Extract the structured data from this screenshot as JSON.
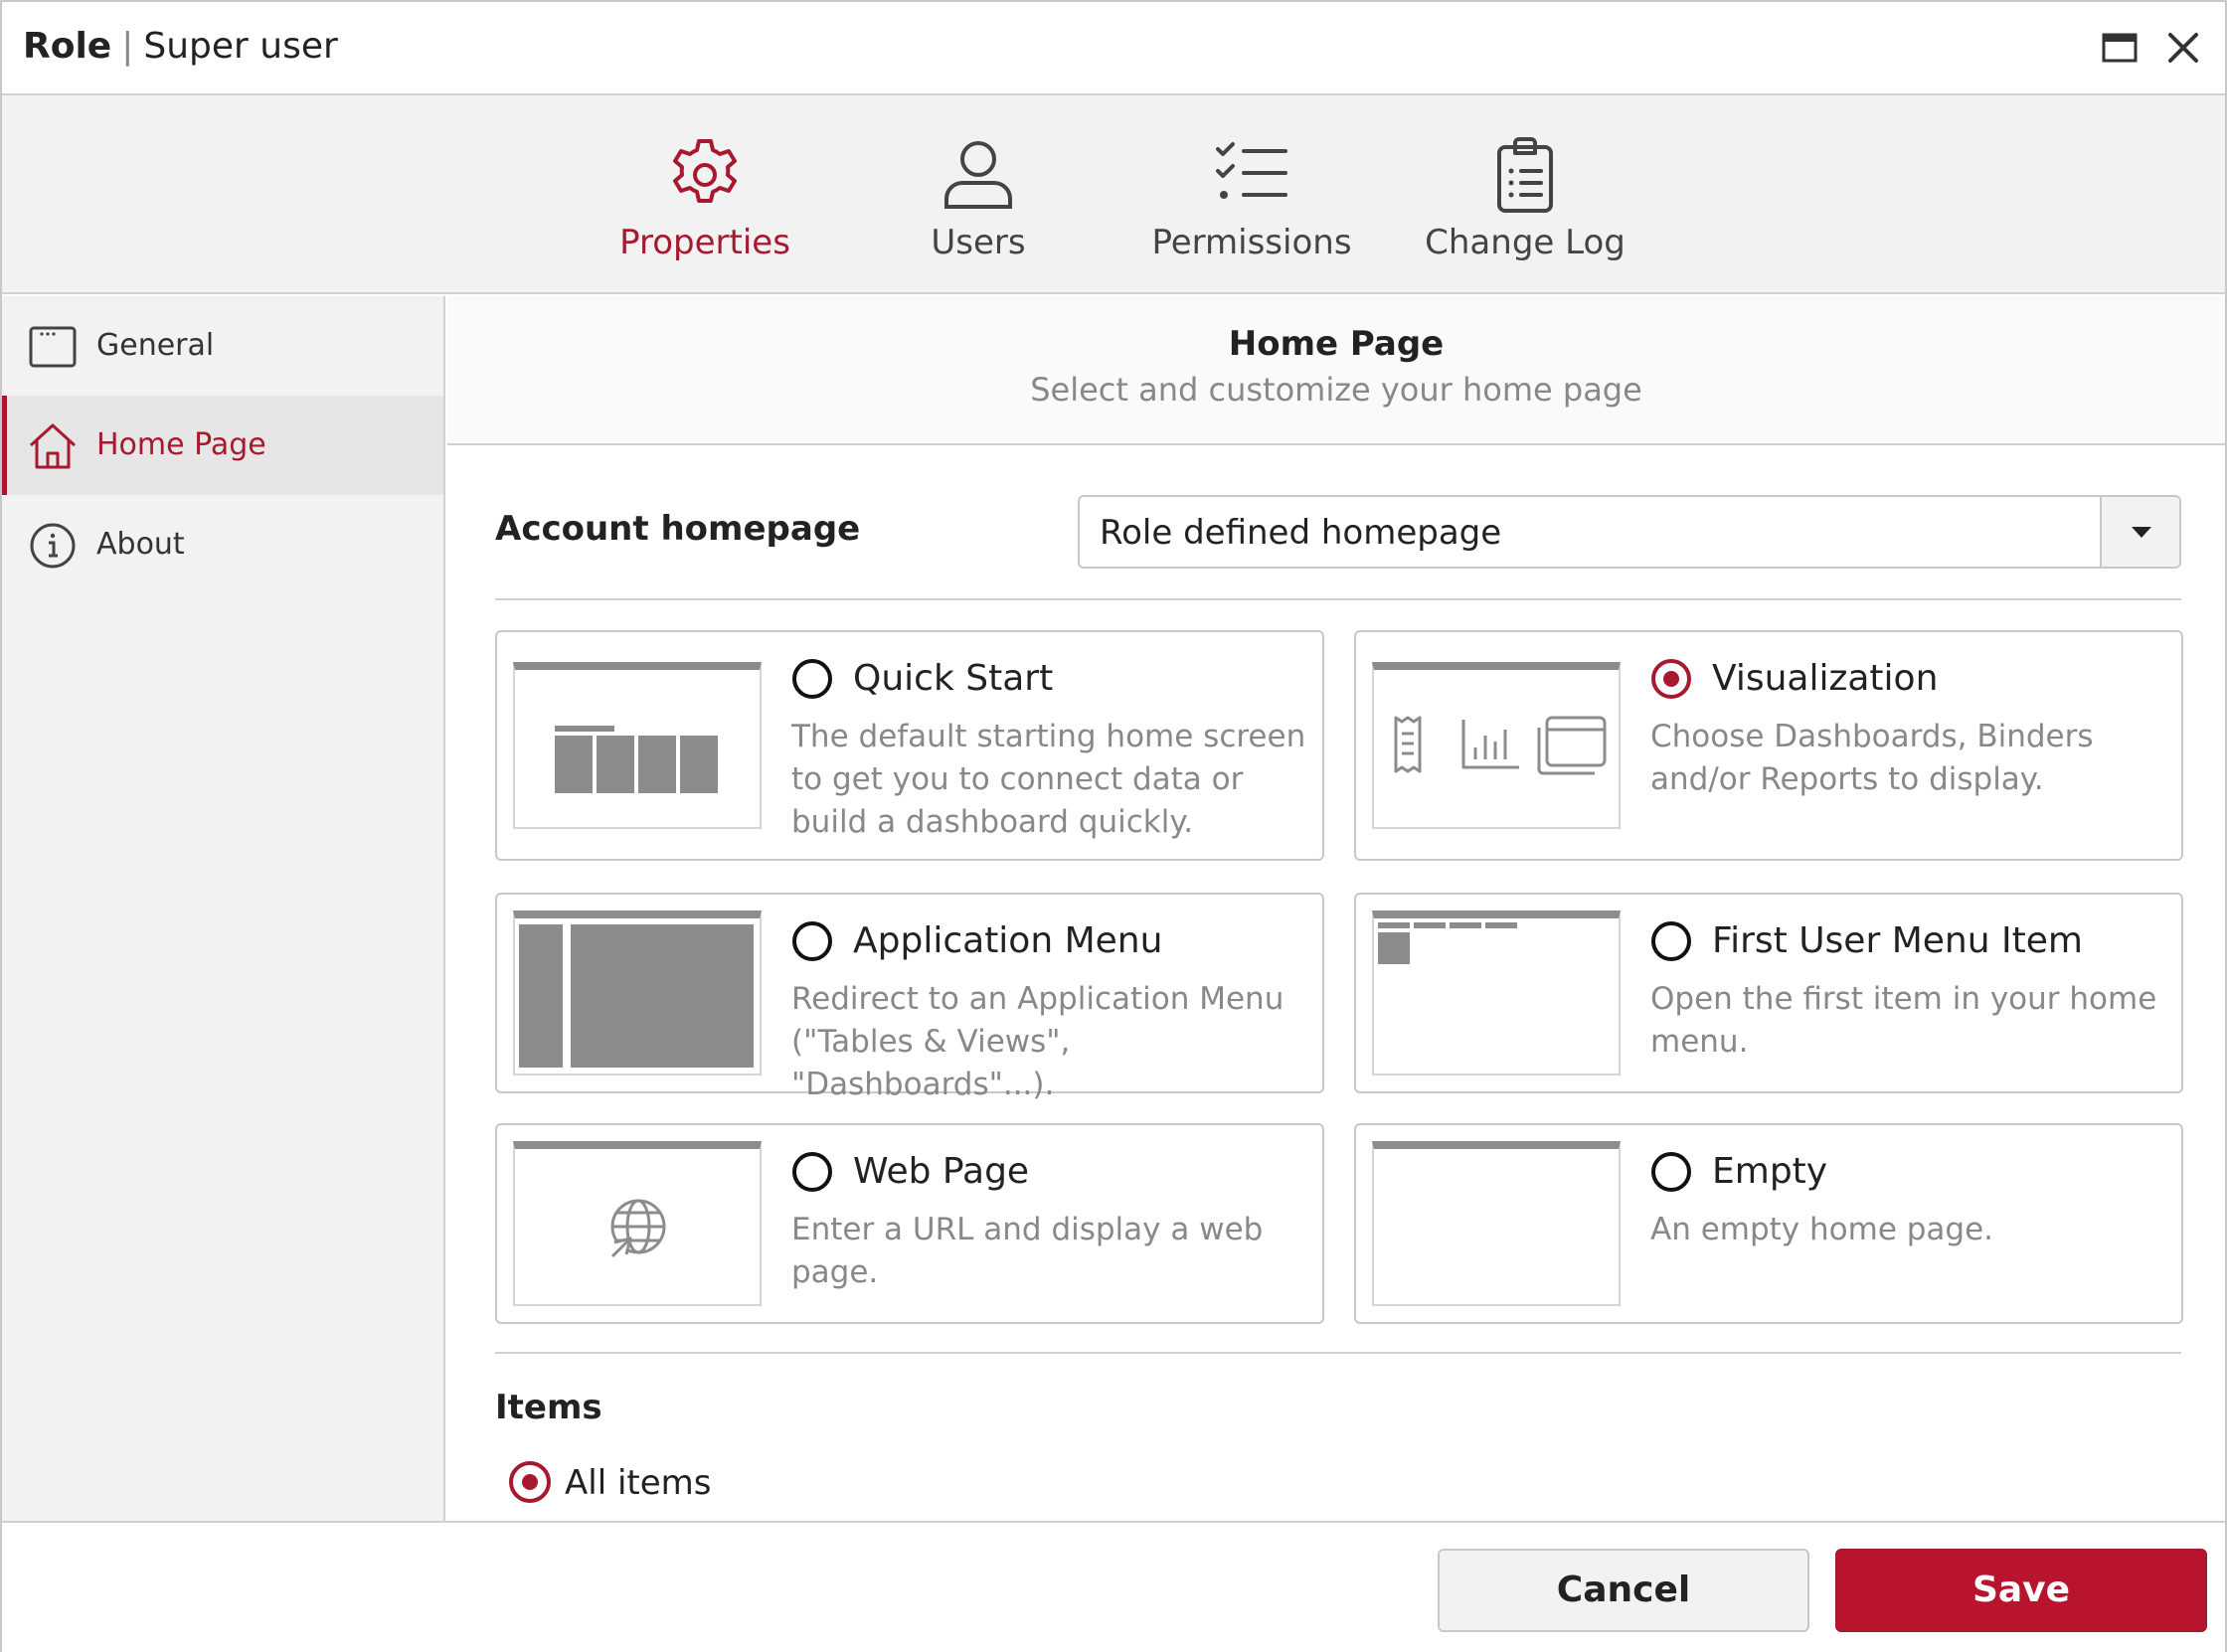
{
  "window": {
    "title_role": "Role",
    "title_separator": "|",
    "title_name": "Super user"
  },
  "tabs": [
    {
      "label": "Properties",
      "icon": "gear-icon",
      "active": true
    },
    {
      "label": "Users",
      "icon": "user-icon",
      "active": false
    },
    {
      "label": "Permissions",
      "icon": "checklist-icon",
      "active": false
    },
    {
      "label": "Change Log",
      "icon": "clipboard-icon",
      "active": false
    }
  ],
  "sidebar": {
    "items": [
      {
        "label": "General",
        "icon": "window-icon",
        "active": false
      },
      {
        "label": "Home Page",
        "icon": "home-icon",
        "active": true
      },
      {
        "label": "About",
        "icon": "info-icon",
        "active": false
      }
    ]
  },
  "main": {
    "title": "Home Page",
    "subtitle": "Select and customize your home page",
    "account_homepage_label": "Account homepage",
    "account_homepage_value": "Role defined homepage",
    "options": [
      {
        "title": "Quick Start",
        "desc": "The default starting home screen to get you to connect data or build a dashboard quickly.",
        "selected": false
      },
      {
        "title": "Visualization",
        "desc": "Choose Dashboards, Binders and/or Reports to display.",
        "selected": true
      },
      {
        "title": "Application Menu",
        "desc": "Redirect to an Application Menu (\"Tables & Views\", \"Dashboards\"...).",
        "selected": false
      },
      {
        "title": "First User Menu Item",
        "desc": "Open the first item in your home menu.",
        "selected": false
      },
      {
        "title": "Web Page",
        "desc": "Enter a URL and display a web page.",
        "selected": false
      },
      {
        "title": "Empty",
        "desc": "An empty home page.",
        "selected": false
      }
    ],
    "items_label": "Items",
    "all_items_label": "All items"
  },
  "footer": {
    "cancel_label": "Cancel",
    "save_label": "Save"
  },
  "colors": {
    "accent": "#a6192e",
    "save_bg": "#b8142e",
    "muted_text": "#888888",
    "panel_bg": "#f2f2f2"
  }
}
